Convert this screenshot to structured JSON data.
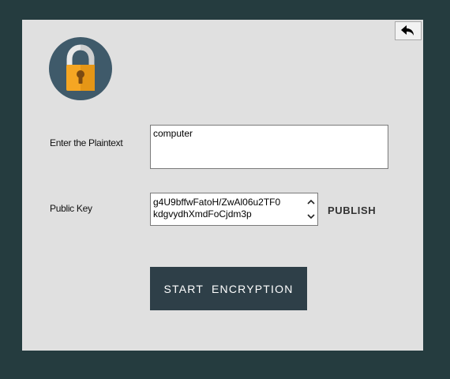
{
  "form": {
    "plaintext_label": "Enter the Plaintext",
    "plaintext_value": "computer",
    "public_key_label": "Public Key",
    "public_key_line1": "g4U9bffwFatoH/ZwAl06u2TF0",
    "public_key_line2": "kdgvydhXmdFoCjdm3p"
  },
  "actions": {
    "publish_label": "PUBLISH",
    "start_label": "START  ENCRYPTION"
  },
  "icons": {
    "logo": "padlock-icon",
    "back": "back-arrow-icon",
    "scroll_up": "chevron-up-icon",
    "scroll_down": "chevron-down-icon"
  },
  "colors": {
    "background": "#253c3f",
    "panel": "#e0e0e0",
    "button": "#2e3f48",
    "lock_circle": "#3f5a6a",
    "lock_body": "#f5a623"
  }
}
